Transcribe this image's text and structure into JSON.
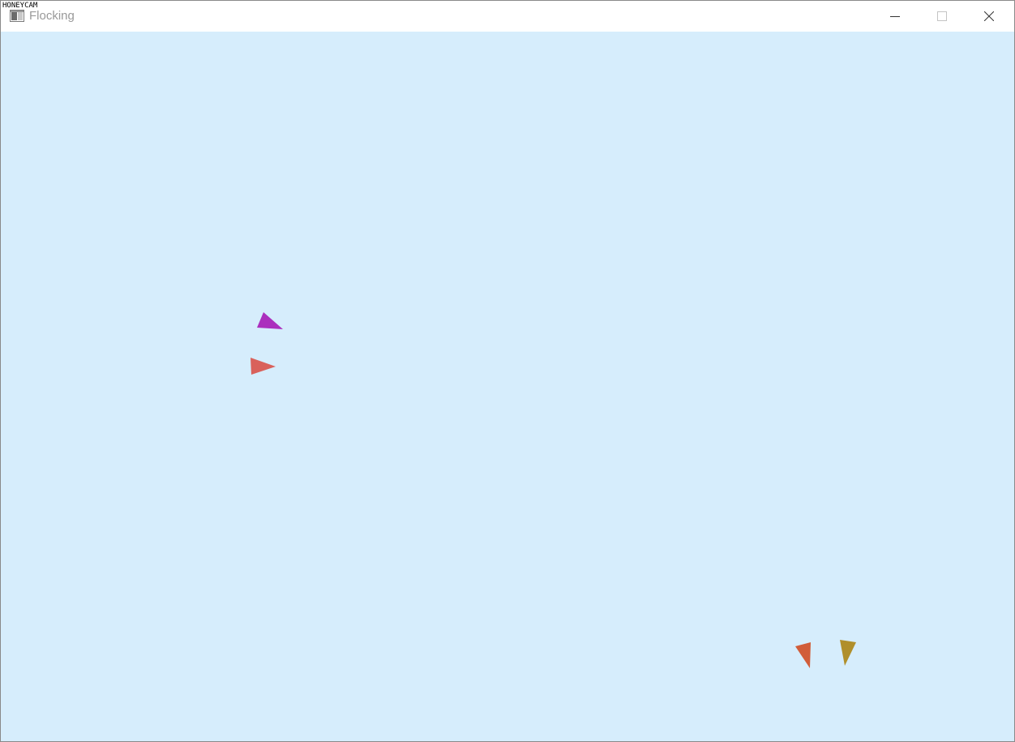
{
  "overlay": {
    "watermark_text": "HONEYCAM"
  },
  "window": {
    "title": "Flocking",
    "app_icon": "app-window-icon",
    "controls": {
      "minimize_icon": "minimize-icon",
      "maximize_icon": "maximize-icon",
      "close_icon": "close-icon"
    }
  },
  "canvas": {
    "background_color": "#d6edfc",
    "boids": [
      {
        "name": "boid-magenta",
        "color": "#ab2fbd"
      },
      {
        "name": "boid-coral",
        "color": "#d9615b"
      },
      {
        "name": "boid-orange",
        "color": "#d15d39"
      },
      {
        "name": "boid-gold",
        "color": "#b08f2b"
      }
    ]
  }
}
